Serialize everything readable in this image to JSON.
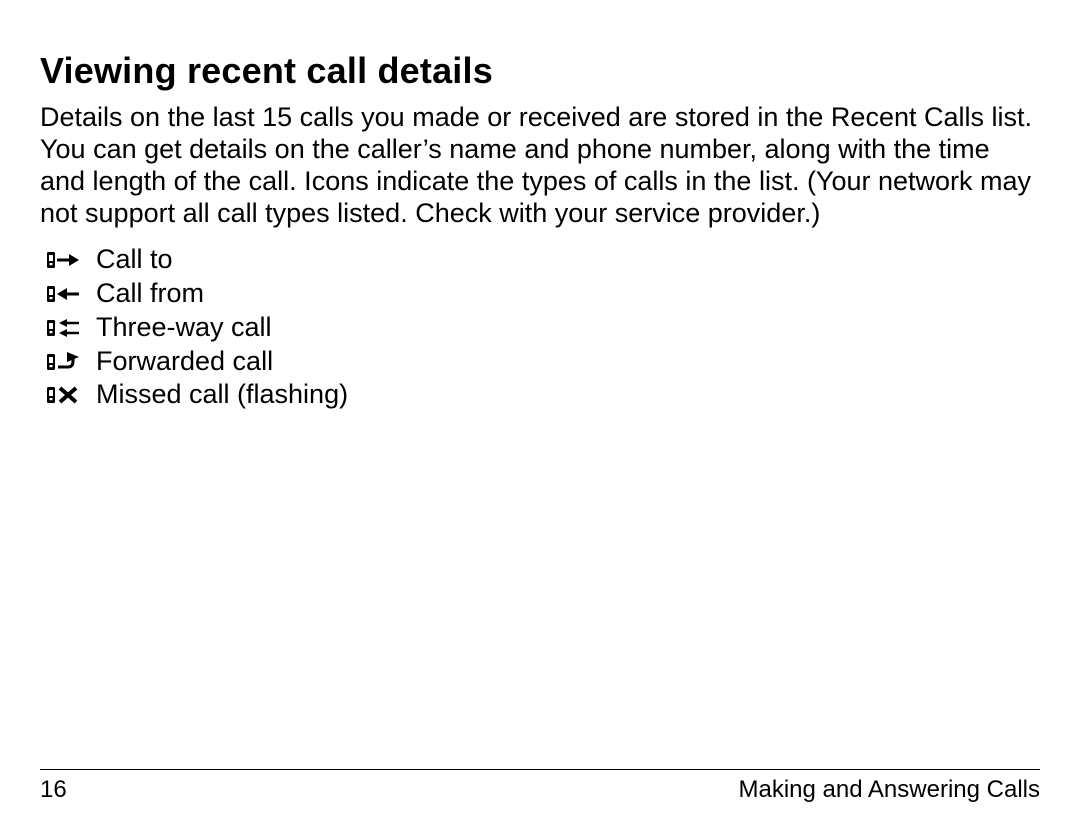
{
  "title": "Viewing recent call details",
  "body": "Details on the last 15 calls you made or received are stored in the Recent Calls list. You can get details on the caller’s name and phone number, along with the time and length of the call. Icons indicate the types of calls in the list. (Your network may not support all call types listed. Check with your service provider.)",
  "items": [
    {
      "label": "Call to",
      "icon": "call-to-icon"
    },
    {
      "label": "Call from",
      "icon": "call-from-icon"
    },
    {
      "label": "Three-way call",
      "icon": "three-way-call-icon"
    },
    {
      "label": "Forwarded call",
      "icon": "forwarded-call-icon"
    },
    {
      "label": "Missed call (flashing)",
      "icon": "missed-call-icon"
    }
  ],
  "footer": {
    "page_number": "16",
    "section": "Making and Answering Calls"
  }
}
